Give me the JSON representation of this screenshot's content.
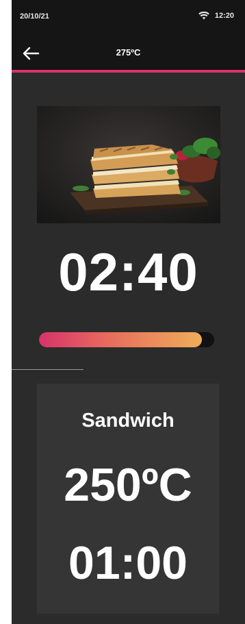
{
  "status_bar": {
    "date": "20/10/21",
    "time": "12:20",
    "wifi_icon": "wifi-icon"
  },
  "header": {
    "back_icon": "arrow-left-icon",
    "title": "275ºC"
  },
  "colors": {
    "accent": "#d8336b",
    "progress_start": "#d7336a",
    "progress_end": "#efad59",
    "background": "#2b2b2b",
    "card": "#353535"
  },
  "cooking": {
    "image": "sandwich-photo",
    "remaining_time": "02:40",
    "progress": 0.93
  },
  "recipe": {
    "name": "Sandwich",
    "temperature": "250ºC",
    "duration": "01:00"
  }
}
